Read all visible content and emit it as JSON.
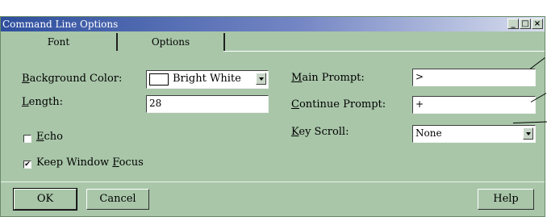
{
  "window": {
    "title": "Command Line Options",
    "controls": {
      "minimize": "_",
      "restore": "□",
      "close": "×"
    }
  },
  "tabs": [
    {
      "label": "Font",
      "active": false
    },
    {
      "label": "Options",
      "active": true
    }
  ],
  "left": {
    "background_color": {
      "label_first": "B",
      "label_rest": "ackground Color:",
      "value": "Bright White",
      "swatch_color": "#ffffff"
    },
    "length": {
      "label_first": "L",
      "label_rest": "ength:",
      "value": "28"
    },
    "echo": {
      "label_first": "E",
      "label_rest": "cho",
      "checked": false
    },
    "keep_focus": {
      "label_prefix": "Keep Window ",
      "label_first": "F",
      "label_rest": "ocus",
      "checked": true,
      "check_glyph": "✔"
    }
  },
  "right": {
    "main_prompt": {
      "label_first": "M",
      "label_rest": "ain Prompt:",
      "value": ">"
    },
    "continue_prompt": {
      "label_first": "C",
      "label_rest": "ontinue Prompt:",
      "value": "+"
    },
    "key_scroll": {
      "label_first": "K",
      "label_rest": "ey Scroll:",
      "value": "None"
    }
  },
  "buttons": {
    "ok": "OK",
    "cancel": "Cancel",
    "help": "Help"
  }
}
